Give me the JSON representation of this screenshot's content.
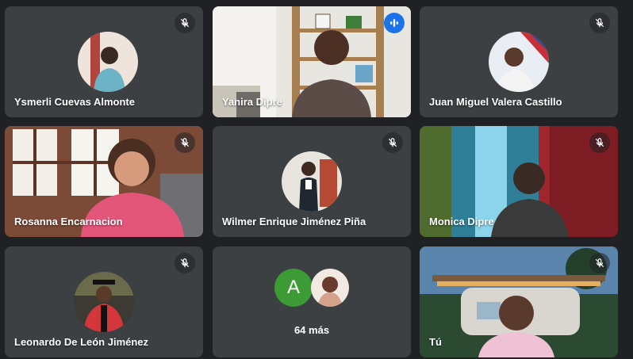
{
  "participants": [
    {
      "name": "Ysmerli Cuevas Almonte",
      "muted": true
    },
    {
      "name": "Yanira Dipre",
      "muted": false,
      "speaking": true
    },
    {
      "name": "Juan Miguel Valera Castillo",
      "muted": true
    },
    {
      "name": "Rosanna Encarnacion",
      "muted": true
    },
    {
      "name": "Wilmer Enrique Jiménez Piña",
      "muted": true
    },
    {
      "name": "Monica Dipre",
      "muted": true
    },
    {
      "name": "Leonardo De León Jiménez",
      "muted": true
    },
    {
      "name": "Tú",
      "muted": true
    }
  ],
  "more_tile": {
    "initial": "A",
    "label": "64 más"
  },
  "icons": {
    "mic_off": "mic-off-icon",
    "speaking": "audio-level-icon"
  },
  "colors": {
    "background": "#202124",
    "tile": "#3c4043",
    "active_border": "#8ab4f8",
    "speaking_badge": "#1a73e8",
    "initial_avatar": "#3d9b35"
  }
}
